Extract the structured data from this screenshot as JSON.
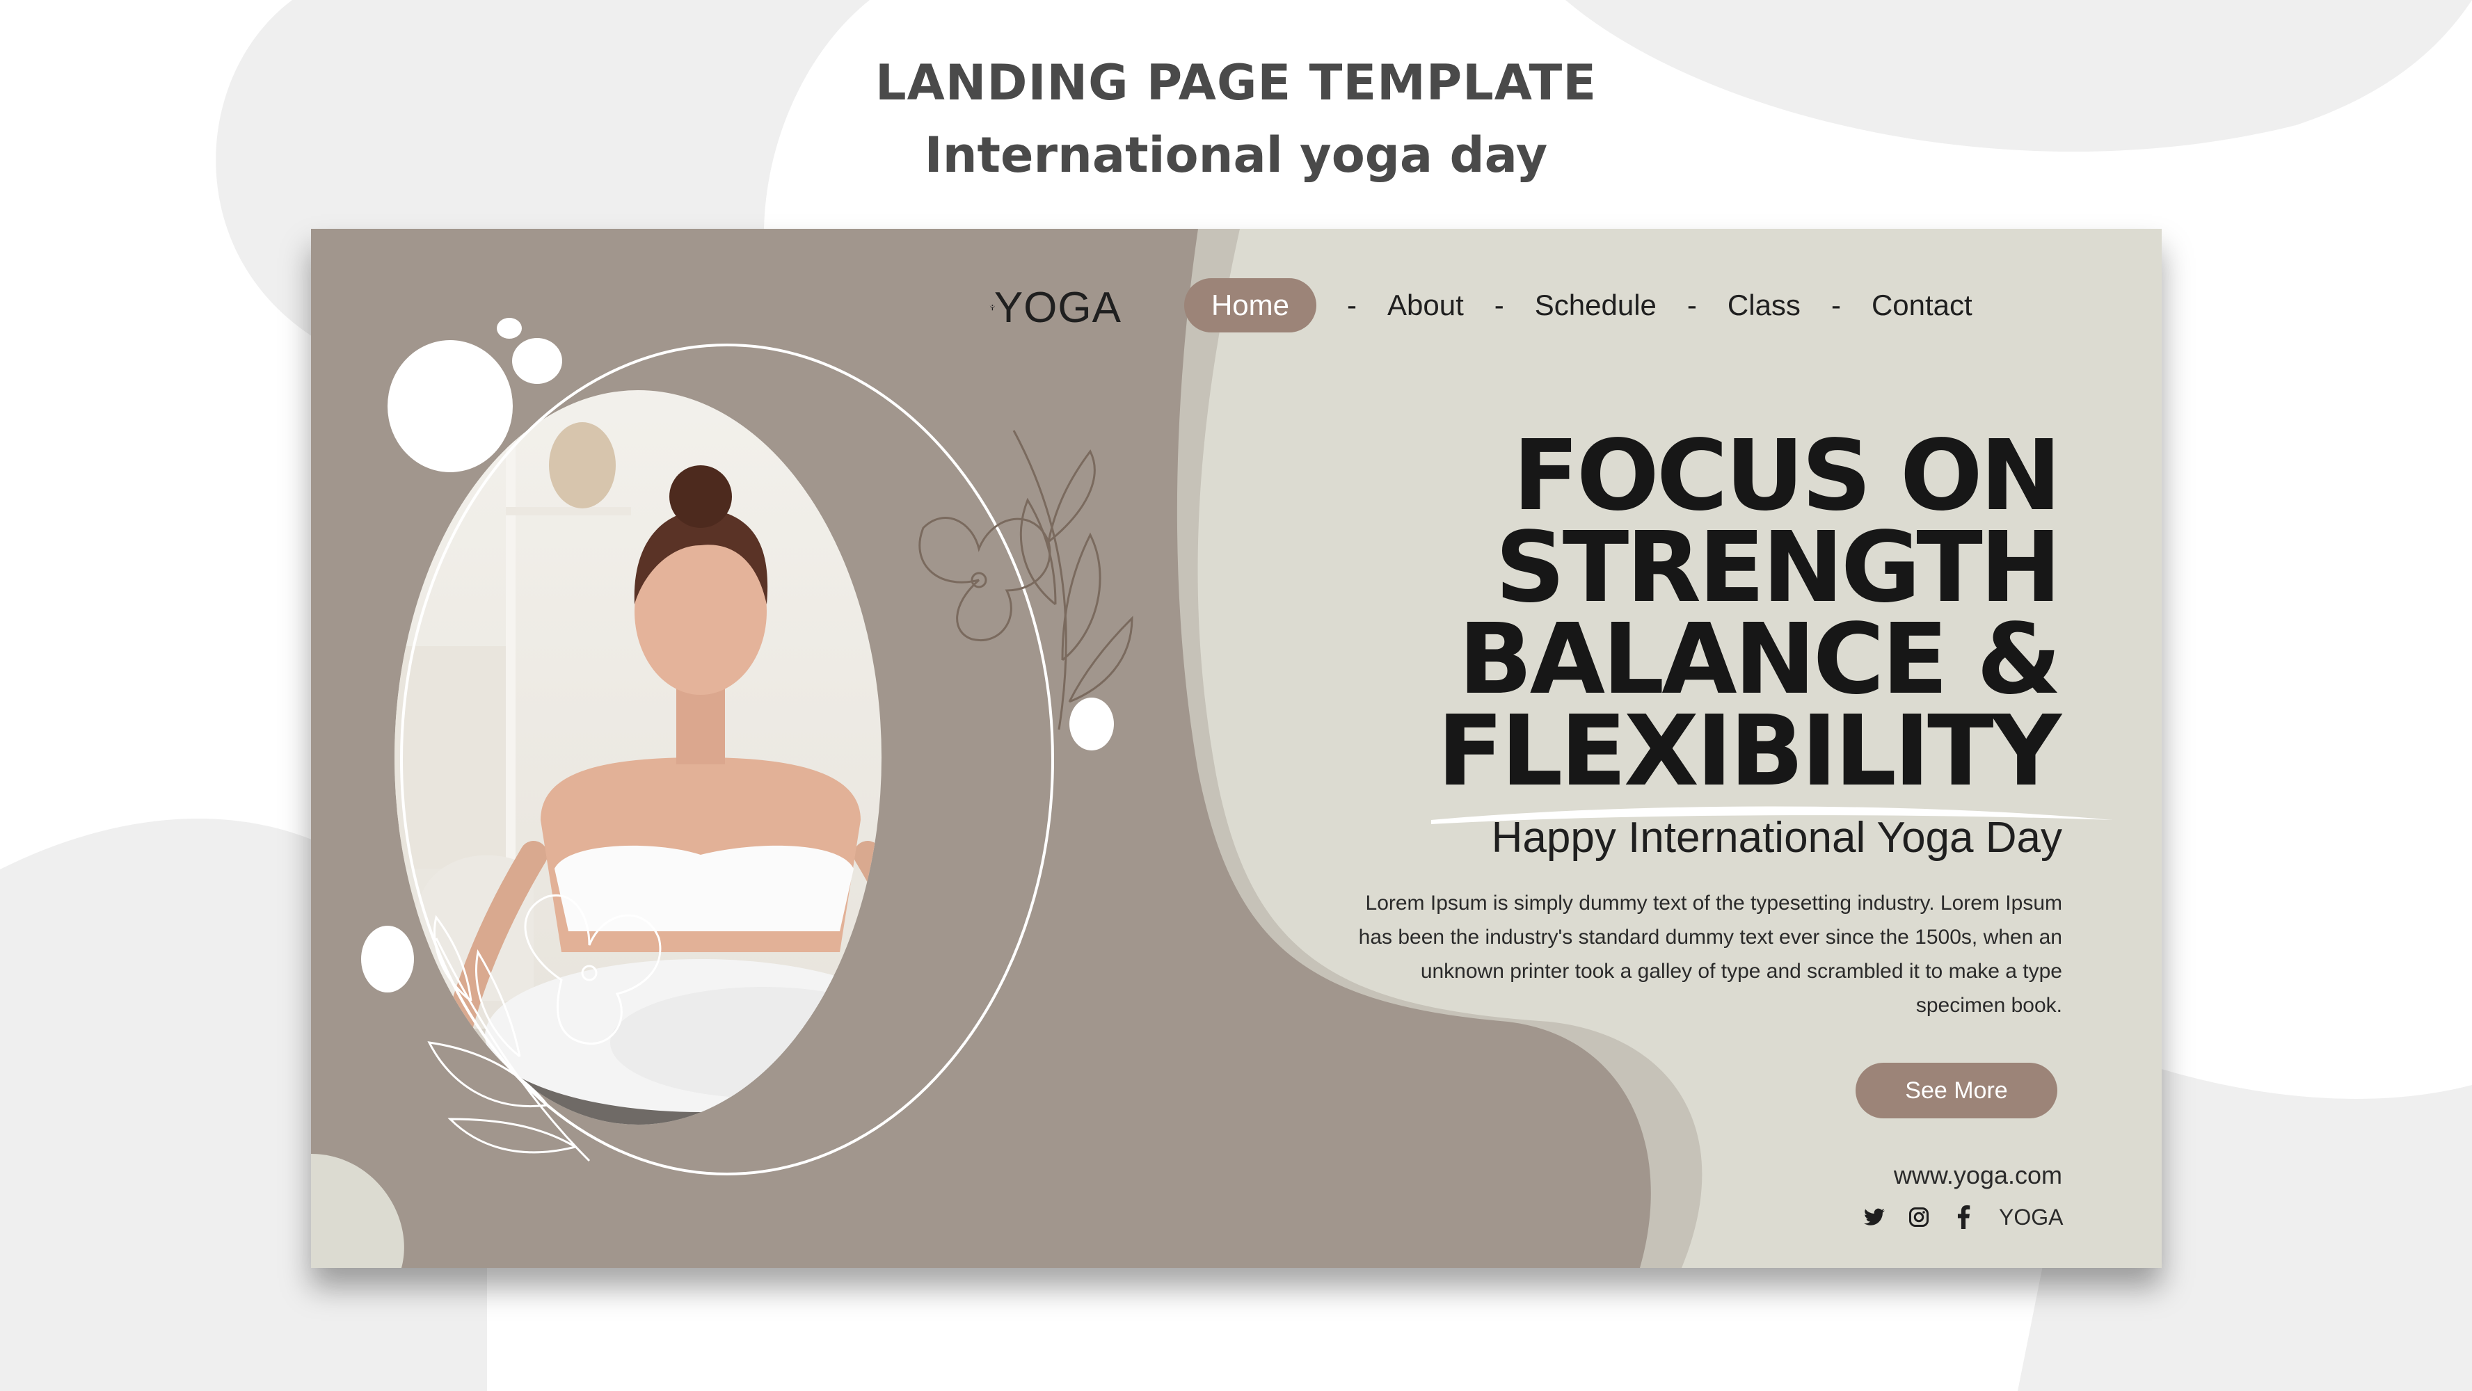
{
  "header": {
    "title": "LANDING PAGE TEMPLATE",
    "subtitle": "International yoga day"
  },
  "brand": {
    "logo_text": "YOGA",
    "logo_icon": "yoga-person-icon"
  },
  "nav": {
    "items": [
      {
        "label": "Home",
        "active": true
      },
      {
        "label": "About",
        "active": false
      },
      {
        "label": "Schedule",
        "active": false
      },
      {
        "label": "Class",
        "active": false
      },
      {
        "label": "Contact",
        "active": false
      }
    ],
    "separator": "-"
  },
  "hero": {
    "headline_lines": [
      "FOCUS ON",
      "STRENGTH",
      "BALANCE &",
      "FLEXIBILITY"
    ],
    "subheading": "Happy International Yoga Day",
    "body": "Lorem Ipsum is simply dummy text of the typesetting industry. Lorem Ipsum has been the industry's standard dummy text ever since the 1500s, when an unknown printer took a galley of type and scrambled it to make a type specimen book.",
    "cta_label": "See More",
    "image": "woman-meditating-photo"
  },
  "footer": {
    "website": "www.yoga.com",
    "social_icons": [
      "twitter-icon",
      "instagram-icon",
      "facebook-icon"
    ],
    "brand": "YOGA"
  },
  "colors": {
    "page_background": "#dcdbd1",
    "blob_dark": "#a1968d",
    "accent": "#9c8478",
    "text": "#171717",
    "outer_background": "#efefef"
  }
}
